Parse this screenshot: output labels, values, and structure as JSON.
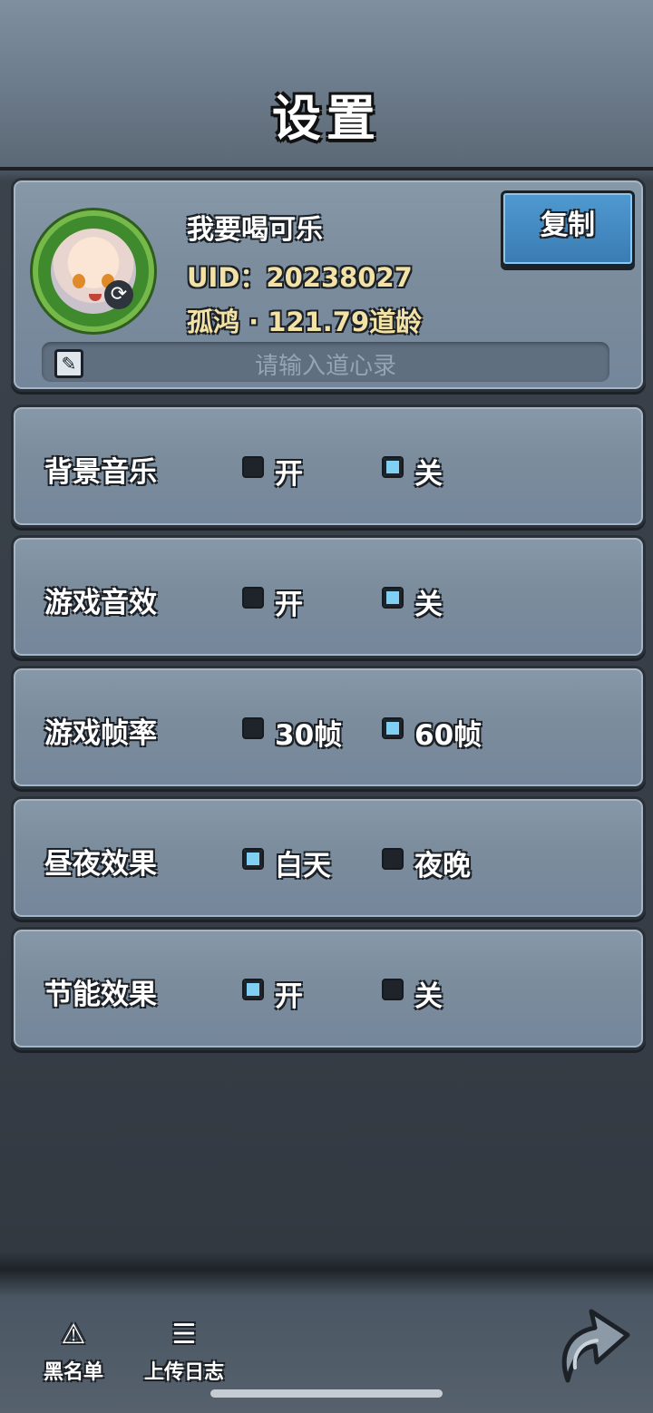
{
  "header": {
    "title": "设置"
  },
  "profile": {
    "nickname": "我要喝可乐",
    "uid_line": "UID：20238027",
    "rank_line": "孤鸿 · 121.79道龄",
    "copy_label": "复制",
    "motto_placeholder": "请输入道心录"
  },
  "settings": [
    {
      "label": "背景音乐",
      "options": [
        {
          "text": "开",
          "selected": false
        },
        {
          "text": "关",
          "selected": true
        }
      ]
    },
    {
      "label": "游戏音效",
      "options": [
        {
          "text": "开",
          "selected": false
        },
        {
          "text": "关",
          "selected": true
        }
      ]
    },
    {
      "label": "游戏帧率",
      "options": [
        {
          "text": "30帧",
          "selected": false
        },
        {
          "text": "60帧",
          "selected": true
        }
      ]
    },
    {
      "label": "昼夜效果",
      "options": [
        {
          "text": "白天",
          "selected": true
        },
        {
          "text": "夜晚",
          "selected": false
        }
      ]
    },
    {
      "label": "节能效果",
      "options": [
        {
          "text": "开",
          "selected": true
        },
        {
          "text": "关",
          "selected": false
        }
      ]
    }
  ],
  "bottom_bar": {
    "blacklist_label": "黑名单",
    "upload_log_label": "上传日志"
  },
  "icons": {
    "refresh": "refresh-icon",
    "edit": "edit-icon",
    "blacklist": "warning-triangle-icon",
    "upload_log": "log-list-icon",
    "back": "back-arrow-icon"
  },
  "colors": {
    "selected_option": "#7fd0f3",
    "unselected_option": "#1f242a",
    "copy_button": "#4f9ad1",
    "uid_text": "#f3e2a6"
  }
}
